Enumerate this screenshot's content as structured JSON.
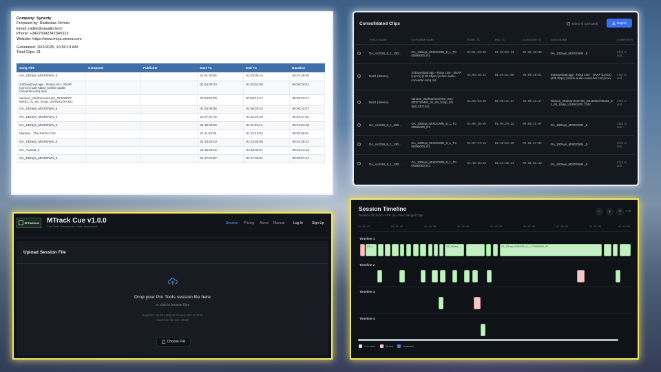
{
  "report": {
    "company": "Company: Synenty",
    "prepared_by": "Prepared by: Radoslaw Ochnio",
    "email": "Email: radek@siaudio.tech",
    "phone": "Phone: +34223342342345323",
    "website": "Website: https://www.moja.strona.com",
    "generated": "Generated: 10/2/2025, 10:36:19 AM",
    "total_clips": "Total Clips: 31",
    "columns": [
      "Song Title",
      "Composer",
      "Publisher",
      "Start TC",
      "End TC",
      "Duration"
    ],
    "rows": [
      [
        "OA_13Days_MIXDOWN_5",
        "",
        "",
        "01:01:30:05",
        "01:03:08:14",
        "00:01:38:09"
      ],
      [
        "X2Download.app - Rosa Linn - SNAP (Lyrics) (128 Kbps) (online-audio-converter.com).mov",
        "",
        "",
        "01:04:30:23",
        "01:04:51:00",
        "00:00:20:01"
      ],
      [
        "Various_VitalSummerHits_G0100027 50492_01_60_Snap_USSM12207342",
        "",
        "",
        "01:04:51:00",
        "01:05:14:17",
        "00:00:23:17"
      ],
      [
        "OA_13Days_MIXDOWN_5",
        "",
        "",
        "01:05:38:05",
        "01:06:20:12",
        "00:00:42:07"
      ],
      [
        "OA_13Days_MIXDOWN_5",
        "",
        "",
        "01:07:37:16",
        "01:10:24:19",
        "00:02:47:02"
      ],
      [
        "OA_13Days_MIXDOWN_5",
        "",
        "",
        "01:10:46:20",
        "01:11:48:14",
        "00:01:01:18"
      ],
      [
        "Maneus - The Perfect Girl",
        "",
        "",
        "01:11:16:02",
        "01:12:15:04",
        "00:00:59:02"
      ],
      [
        "OA_13Days_MIXDOWN_5",
        "",
        "",
        "01:13:26:10",
        "01:14:55:08",
        "00:01:28:22"
      ],
      [
        "OA_AUG26_5",
        "",
        "",
        "01:15:49:16",
        "01:18:02:07",
        "00:02:13:12"
      ],
      [
        "OA_13Days_MIXDOWN_5",
        "",
        "",
        "01:17:21:07",
        "01:17:48:21",
        "00:00:27:14"
      ]
    ]
  },
  "clips_panel": {
    "title": "Consolidated Clips",
    "select_all": "Select All (Unmuted)",
    "export_label": "Export",
    "columns": [
      "",
      "TRACK NAME",
      "CLIP/ANIM NAME",
      "START TC",
      "END TC",
      "DURATION TC",
      "SONG NAME",
      "COMPOSER"
    ],
    "rows": [
      [
        "OA_AUG26_5_1_13D...",
        "OA_13Days_MIXDOWN_5_1_TC 00595000_R1",
        "01:01:30:05",
        "01:03:08:14",
        "00:01:38:09",
        "OA_13Days_MIXDOWN _5",
        "Click to add..."
      ],
      [
        "Mo01 (Stereo)",
        "X2Download.app - Rosa Linn - SNAP (Lyrics) (128 Kbps) (online-audio-converter.com).m4",
        "01:04:30:23",
        "01:04:51:00",
        "00:00:20:01",
        "X2Download.app - Rosa Linn - SNAP (Lyrics) (128 Kbps) (online-audio-converter.com).mov",
        "Click to add..."
      ],
      [
        "Mo01 (Stereo)",
        "Various_VitalSummerHits_G01 00027S0492_01_60_Snap_US SM12207342",
        "01:04:51:00",
        "01:05:14:17",
        "00:00:23:17",
        "Various_VitalSummerHits_G0100027S0492_0 1_60_Snap_USSM1220 7342",
        "Click to add..."
      ],
      [
        "OA_AUG26_5_1_13D...",
        "OA_13Days_MIXDOWN_5_1_TC 00595000_R1",
        "01:05:38:05",
        "01:06:20:12",
        "00:00:42:07",
        "OA_13Days_MIXDOWN _5",
        "Click to add..."
      ],
      [
        "OA_AUG26_5_1_13D...",
        "OA_13Days_MIXDOWN_5_1_TC 00595000_R1",
        "01:07:37:16",
        "01:10:24:19",
        "00:02:47:02",
        "OA_13Days_MIXDOWN _5",
        "Click to add..."
      ],
      [
        "OA_AUG26_5_1_13D...",
        "OA_13Days_MIXDOWN_5_1_TC 00595000_R1",
        "01:10:46:20",
        "01:11:48:14",
        "00:01:01:18",
        "OA_13Days_MIXDOWN _5",
        "Click to add..."
      ]
    ]
  },
  "mtrack": {
    "logo_text": "MTrackCue",
    "title": "MTrack Cue v1.0.0",
    "subtitle": "Cue Sheet Generator for Music Supervisors",
    "nav": [
      "Session",
      "Pricing",
      "About",
      "Manual",
      "Log In",
      "Sign Up"
    ],
    "card_title": "Upload Session File",
    "drop_title": "Drop your Pro Tools session file here",
    "drop_sub": "or click to browse files",
    "supports": "Supports: .txt files (Export Session Info as Text)",
    "max_size": "Maximum file size: 10MB",
    "choose_file": "Choose File"
  },
  "timeline": {
    "title": "Session Timeline",
    "subtitle": "Duration: 01:28:53 • FPS: 24 • View: Merged Clips",
    "zoom": "1.0x",
    "ticks": [
      "01:00:00",
      "01:05:00",
      "01:10:00",
      "01:15:00",
      "01:20:00",
      "01:25:00",
      "01:30:00",
      "01:35:00",
      "01:40:00"
    ],
    "tracks": [
      "Timeline 1",
      "Timeline 2",
      "Timeline 3",
      "Timeline 4"
    ],
    "clip_labels": {
      "t1_a": "OA_1...",
      "t1_b": "OA_13Days_...",
      "t1_c": "OA_13Days_MIXDOWN_5_1_TC00595000_R1"
    },
    "legend": [
      "Unmuted",
      "Muted",
      "Selected"
    ],
    "colors": {
      "unmuted": "#c4efc4",
      "muted": "#f2c9c9",
      "selected": "#4a7fd8"
    }
  }
}
